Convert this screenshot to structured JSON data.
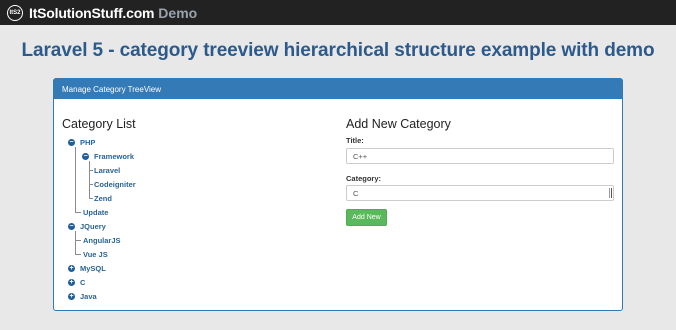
{
  "topbar": {
    "logo_text": "ItS2",
    "brand": "ItSolutionStuff.com",
    "brand_suffix": "Demo"
  },
  "page_title": "Laravel 5 - category treeview hierarchical structure example with demo",
  "panel": {
    "heading": "Manage Category TreeView"
  },
  "category_list": {
    "title": "Category List",
    "items": {
      "php": "PHP",
      "framework": "Framework",
      "laravel": "Laravel",
      "codeigniter": "Codeigniter",
      "zend": "Zend",
      "update": "Update",
      "jquery": "JQuery",
      "angularjs": "AngularJS",
      "vuejs": "Vue JS",
      "mysql": "MySQL",
      "c": "C",
      "java": "Java"
    },
    "toggles": {
      "minus": "−",
      "plus": "+"
    }
  },
  "form": {
    "title": "Add New Category",
    "title_label": "Title:",
    "title_value": "C++",
    "category_label": "Category:",
    "category_selected": "C",
    "submit_label": "Add New"
  },
  "colors": {
    "brand_blue": "#337ab7",
    "heading_blue": "#2c5a8c",
    "link_blue": "#2a6496",
    "success_green": "#5cb85c"
  }
}
